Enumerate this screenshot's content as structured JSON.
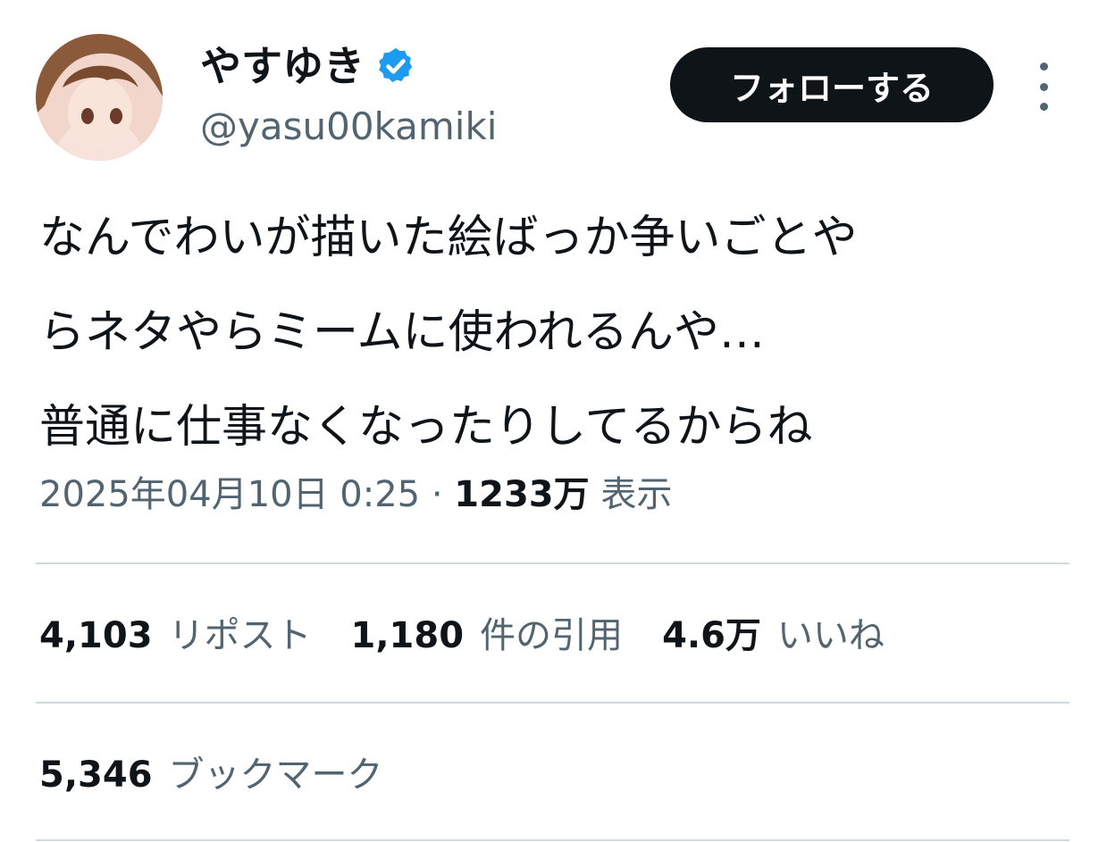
{
  "author": {
    "display_name": "やすゆき",
    "handle": "@yasu00kamiki",
    "verified": true
  },
  "follow_label": "フォローする",
  "tweet": {
    "lines": [
      "なんでわいが描いた絵ばっか争いごとや",
      "らネタやらミームに使われるんや…",
      "普通に仕事なくなったりしてるからね"
    ]
  },
  "meta": {
    "datetime": "2025年04月10日 0:25",
    "separator": "·",
    "views": "1233万",
    "views_label": "表示"
  },
  "stats": [
    {
      "count": "4,103",
      "label": "リポスト"
    },
    {
      "count": "1,180",
      "label": "件の引用"
    },
    {
      "count": "4.6万",
      "label": "いいね"
    }
  ],
  "bookmarks": {
    "count": "5,346",
    "label": "ブックマーク"
  },
  "colors": {
    "text": "#0f1419",
    "secondary": "#536471",
    "verified": "#1d9bf0",
    "divider": "#cfd9de"
  }
}
